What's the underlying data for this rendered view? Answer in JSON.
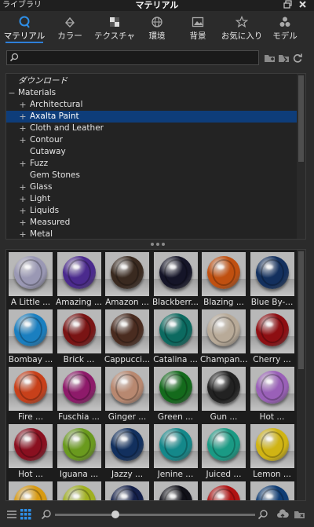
{
  "window": {
    "panel_name": "ライブラリ",
    "title": "マテリアル"
  },
  "tabs": [
    {
      "label": "マテリアル",
      "icon": "material-icon",
      "active": true
    },
    {
      "label": "カラー",
      "icon": "color-icon",
      "active": false
    },
    {
      "label": "テクスチャ",
      "icon": "texture-icon",
      "active": false
    },
    {
      "label": "環境",
      "icon": "environment-icon",
      "active": false
    },
    {
      "label": "背景",
      "icon": "background-icon",
      "active": false
    },
    {
      "label": "お気に入り",
      "icon": "favorites-icon",
      "active": false
    },
    {
      "label": "モデル",
      "icon": "models-icon",
      "active": false
    }
  ],
  "search": {
    "value": "",
    "placeholder": ""
  },
  "tree": {
    "items": [
      {
        "label": "ダウンロード",
        "expander": "",
        "indent": 0,
        "italic": true
      },
      {
        "label": "Materials",
        "expander": "−",
        "indent": 0
      },
      {
        "label": "Architectural",
        "expander": "+",
        "indent": 1
      },
      {
        "label": "Axalta Paint",
        "expander": "+",
        "indent": 1,
        "selected": true
      },
      {
        "label": "Cloth and Leather",
        "expander": "+",
        "indent": 1
      },
      {
        "label": "Contour",
        "expander": "+",
        "indent": 1
      },
      {
        "label": "Cutaway",
        "expander": "",
        "indent": 1
      },
      {
        "label": "Fuzz",
        "expander": "+",
        "indent": 1
      },
      {
        "label": "Gem Stones",
        "expander": "",
        "indent": 1
      },
      {
        "label": "Glass",
        "expander": "+",
        "indent": 1
      },
      {
        "label": "Light",
        "expander": "+",
        "indent": 1
      },
      {
        "label": "Liquids",
        "expander": "+",
        "indent": 1
      },
      {
        "label": "Measured",
        "expander": "+",
        "indent": 1
      },
      {
        "label": "Metal",
        "expander": "+",
        "indent": 1
      }
    ]
  },
  "materials": [
    {
      "name": "A Little ...",
      "color": "#9a98b4"
    },
    {
      "name": "Amazing ...",
      "color": "#4b2a8e"
    },
    {
      "name": "Amazon ...",
      "color": "#3a2a20"
    },
    {
      "name": "Blackberr...",
      "color": "#151528"
    },
    {
      "name": "Blazing ...",
      "color": "#c05010"
    },
    {
      "name": "Blue By-...",
      "color": "#13305e"
    },
    {
      "name": "Bombay ...",
      "color": "#1a7fc0"
    },
    {
      "name": "Brick ...",
      "color": "#7a1414"
    },
    {
      "name": "Cappucci...",
      "color": "#4a2c20"
    },
    {
      "name": "Catalina ...",
      "color": "#0c6a60"
    },
    {
      "name": "Champan...",
      "color": "#b8aa98"
    },
    {
      "name": "Cherry ...",
      "color": "#8e0e12"
    },
    {
      "name": "Fire ...",
      "color": "#c8401a"
    },
    {
      "name": "Fuschia ...",
      "color": "#8e1a6a"
    },
    {
      "name": "Ginger ...",
      "color": "#b88870"
    },
    {
      "name": "Green ...",
      "color": "#146a1c"
    },
    {
      "name": "Gun ...",
      "color": "#222222"
    },
    {
      "name": "Hot ...",
      "color": "#9a60b8"
    },
    {
      "name": "Hot ...",
      "color": "#8a1020"
    },
    {
      "name": "Iguana ...",
      "color": "#6a9a1e"
    },
    {
      "name": "Jazzy ...",
      "color": "#12305e"
    },
    {
      "name": "Jenine ...",
      "color": "#14888a"
    },
    {
      "name": "Juiced ...",
      "color": "#1a9a84"
    },
    {
      "name": "Lemon ...",
      "color": "#d0b414"
    },
    {
      "name": "",
      "color": "#d89a12"
    },
    {
      "name": "",
      "color": "#a0b020"
    },
    {
      "name": "",
      "color": "#14204a"
    },
    {
      "name": "",
      "color": "#101018"
    },
    {
      "name": "",
      "color": "#b01212"
    },
    {
      "name": "",
      "color": "#0e3c74"
    }
  ],
  "zoom_level": 0.3,
  "colors": {
    "accent": "#2e7fd8",
    "selection": "#0e3d7a"
  }
}
